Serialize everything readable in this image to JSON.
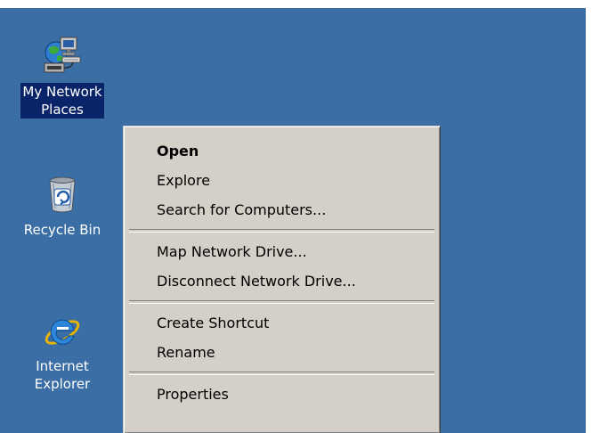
{
  "desktop": {
    "background_color": "#3a6ea5",
    "icons": [
      {
        "label": "My Network\nPlaces",
        "icon": "network-places-icon",
        "selected": true
      },
      {
        "label": "Recycle Bin",
        "icon": "recycle-bin-icon",
        "selected": false
      },
      {
        "label": "Internet\nExplorer",
        "icon": "internet-explorer-icon",
        "selected": false
      }
    ]
  },
  "context_menu": {
    "items": [
      {
        "label": "Open",
        "default": true
      },
      {
        "label": "Explore"
      },
      {
        "label": "Search for Computers..."
      },
      {
        "label": "Map Network Drive..."
      },
      {
        "label": "Disconnect Network Drive..."
      },
      {
        "label": "Create Shortcut"
      },
      {
        "label": "Rename"
      },
      {
        "label": "Properties"
      }
    ]
  }
}
